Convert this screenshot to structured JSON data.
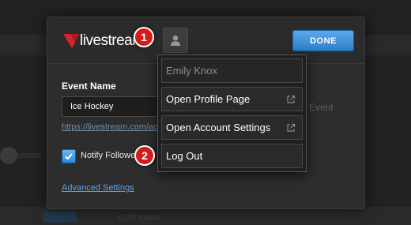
{
  "logo": {
    "text": "livestream",
    "brand_color": "#d7242a"
  },
  "header": {
    "done_label": "DONE",
    "avatar_icon": "user-icon"
  },
  "form": {
    "event_name_label": "Event Name",
    "event_name_value": "Ice Hockey",
    "event_url": "https://livestream.com/ac",
    "right_text": "Event",
    "notify_label": "Notify Followers",
    "notify_checked": true,
    "advanced_link": "Advanced Settings"
  },
  "dropdown": {
    "user_name": "Emily Knox",
    "items": [
      {
        "label": "Open Profile Page",
        "icon": "external-link-icon"
      },
      {
        "label": "Open Account Settings",
        "icon": "external-link-icon"
      },
      {
        "label": "Log Out"
      }
    ]
  },
  "markers": [
    "1",
    "2"
  ],
  "background": {
    "custom_label": "Custom",
    "views_text": "0.00 Views"
  }
}
